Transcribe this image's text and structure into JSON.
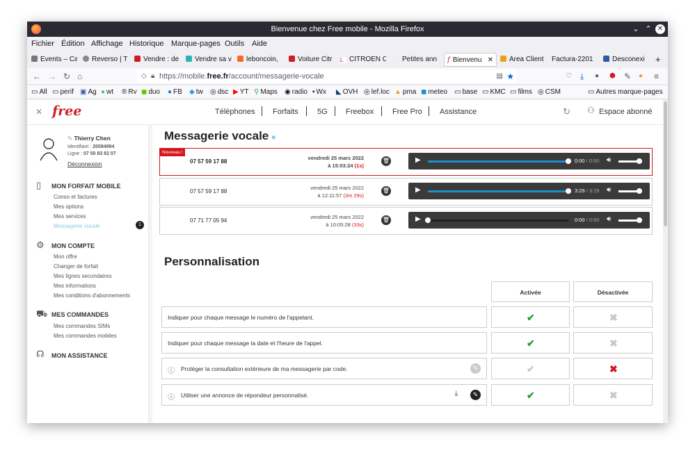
{
  "window": {
    "title": "Bienvenue chez Free mobile - Mozilla Firefox"
  },
  "menubar": [
    "Fichier",
    "Édition",
    "Affichage",
    "Historique",
    "Marque-pages",
    "Outils",
    "Aide"
  ],
  "tabs": [
    {
      "label": "Events – Ca",
      "color": "#777"
    },
    {
      "label": "Reverso | T",
      "color": "#888"
    },
    {
      "label": "Vendre : de",
      "color": "#cd1e25"
    },
    {
      "label": "Vendre sa v",
      "color": "#2ab3b3"
    },
    {
      "label": "leboncoin,",
      "color": "#f56b2a"
    },
    {
      "label": "Voiture Citr",
      "color": "#cd1e25"
    },
    {
      "label": "CITROEN C",
      "color": "#cd1e25"
    },
    {
      "label": "Petites ann",
      "color": "#ccc"
    },
    {
      "label": "Bienvenu",
      "color": "#cd1e25"
    },
    {
      "label": "Area Client",
      "color": "#e9a21a"
    },
    {
      "label": "Factura-2201",
      "color": "#ccc"
    },
    {
      "label": "Desconexi",
      "color": "#2b5ca6"
    }
  ],
  "url": {
    "prefix": "https://mobile.",
    "domain": "free.fr",
    "path": "/account/messagerie-vocale"
  },
  "bookmarks": [
    "All",
    "perif",
    "Ag",
    "wt",
    "Rv",
    "duo",
    "FB",
    "tw",
    "dsc",
    "YT",
    "Maps",
    "radio",
    "Wx",
    "OVH",
    "lef.loc",
    "pma",
    "meteo",
    "base",
    "KMC",
    "films",
    "CSM"
  ],
  "bookmarks_other": "Autres marque-pages",
  "site": {
    "logo": "free",
    "nav": [
      "Téléphones",
      "Forfaits",
      "5G",
      "Freebox",
      "Free Pro",
      "Assistance"
    ],
    "account": "Espace abonné"
  },
  "user": {
    "name": "Thierry Chen",
    "id_label": "Identifiant :",
    "id": "20084994",
    "line_label": "Ligne :",
    "line": "07 50 83 82 07",
    "logout": "Déconnexion"
  },
  "sidebar": {
    "forfait": {
      "title": "MON FORFAIT MOBILE",
      "links": [
        "Conso et factures",
        "Mes options",
        "Mes services",
        "Messagerie vocale"
      ],
      "badge": "1"
    },
    "compte": {
      "title": "MON COMPTE",
      "links": [
        "Mon offre",
        "Changer de forfait",
        "Mes lignes secondaires",
        "Mes informations",
        "Mes conditions d'abonnements"
      ]
    },
    "commandes": {
      "title": "MES COMMANDES",
      "links": [
        "Mes commandes SIMs",
        "Mes commandes mobiles"
      ]
    },
    "assistance": {
      "title": "MON ASSISTANCE"
    }
  },
  "voicemail": {
    "title": "Messagerie vocale",
    "new_label": "Nouveau !",
    "messages": [
      {
        "number": "07 57 59 17 88",
        "date": "vendredi 25 mars 2022",
        "time": "à 15:03:24",
        "dur": "(1s)",
        "played": "0:00",
        "total": "0:00",
        "progress": 1.0,
        "new": true
      },
      {
        "number": "07 57 59 17 88",
        "date": "vendredi 25 mars 2022",
        "time": "à 12:11:57",
        "dur": "(3m 29s)",
        "played": "3:29",
        "total": "3:29",
        "progress": 1.0,
        "new": false
      },
      {
        "number": "07 71 77 05 94",
        "date": "vendredi 25 mars 2022",
        "time": "à 10:05:28",
        "dur": "(33s)",
        "played": "0:00",
        "total": "0:00",
        "progress": 0.0,
        "new": false
      }
    ]
  },
  "perso": {
    "title": "Personnalisation",
    "col_on": "Activée",
    "col_off": "Désactivée",
    "rows": [
      {
        "label": "Indiquer pour chaque message le numéro de l'appelant.",
        "state": "on"
      },
      {
        "label": "Indiquer pour chaque message la date et l'heure de l'appel.",
        "state": "on"
      },
      {
        "label": "Protéger la consultation extérieure de ma messagerie par code.",
        "state": "off"
      },
      {
        "label": "Utiliser une annonce de répondeur personnalisé.",
        "state": "on"
      }
    ]
  }
}
